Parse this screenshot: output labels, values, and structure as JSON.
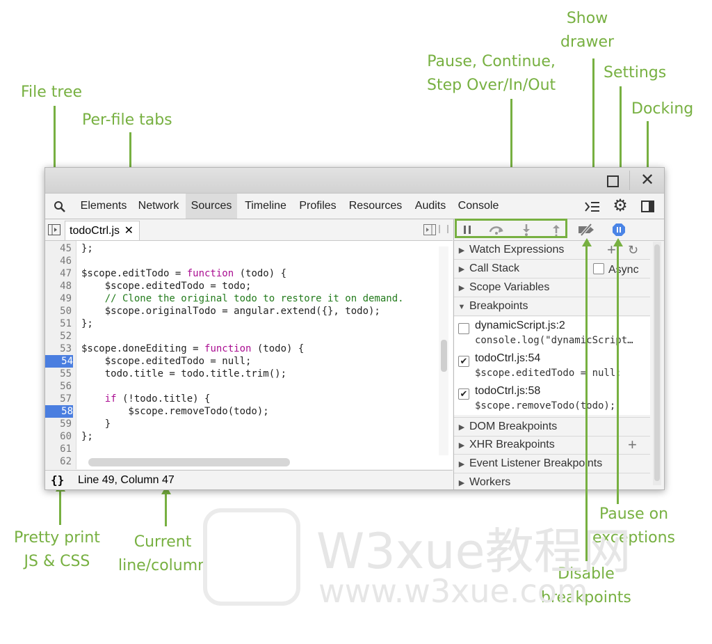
{
  "annotations": {
    "file_tree": "File tree",
    "per_file_tabs": "Per-file tabs",
    "pause_line1": "Pause, Continue,",
    "pause_line2": "Step Over/In/Out",
    "show_drawer_line1": "Show",
    "show_drawer_line2": "drawer",
    "settings": "Settings",
    "docking": "Docking",
    "pretty_print_line1": "Pretty print",
    "pretty_print_line2": "JS & CSS",
    "current_line1": "Current",
    "current_line2": "line/column",
    "pause_exc_line1": "Pause on",
    "pause_exc_line2": "exceptions",
    "disable_bp_line1": "Disable",
    "disable_bp_line2": "breakpoints",
    "color": "#77b041"
  },
  "watermark": {
    "line1": "W3xue教程网",
    "line2": "www.w3xue.com"
  },
  "devtools": {
    "tabs": [
      "Elements",
      "Network",
      "Sources",
      "Timeline",
      "Profiles",
      "Resources",
      "Audits",
      "Console"
    ],
    "active_tab": "Sources",
    "file_tab": "todoCtrl.js",
    "code_lines": [
      {
        "n": "45",
        "bp": false,
        "text": "};"
      },
      {
        "n": "46",
        "bp": false,
        "text": ""
      },
      {
        "n": "47",
        "bp": false,
        "text": "$scope.editTodo = ",
        "kw": "function",
        "rest": " (todo) {"
      },
      {
        "n": "48",
        "bp": false,
        "text": "    $scope.editedTodo = todo;"
      },
      {
        "n": "49",
        "bp": false,
        "comment": "    // Clone the original todo to restore it on demand."
      },
      {
        "n": "50",
        "bp": false,
        "text": "    $scope.originalTodo = angular.extend({}, todo);"
      },
      {
        "n": "51",
        "bp": false,
        "text": "};"
      },
      {
        "n": "52",
        "bp": false,
        "text": ""
      },
      {
        "n": "53",
        "bp": false,
        "text": "$scope.doneEditing = ",
        "kw": "function",
        "rest": " (todo) {"
      },
      {
        "n": "54",
        "bp": true,
        "text": "    $scope.editedTodo = null;"
      },
      {
        "n": "55",
        "bp": false,
        "text": "    todo.title = todo.title.trim();"
      },
      {
        "n": "56",
        "bp": false,
        "text": ""
      },
      {
        "n": "57",
        "bp": false,
        "text": "    ",
        "kw": "if",
        "rest": " (!todo.title) {"
      },
      {
        "n": "58",
        "bp": true,
        "text": "        $scope.removeTodo(todo);"
      },
      {
        "n": "59",
        "bp": false,
        "text": "    }"
      },
      {
        "n": "60",
        "bp": false,
        "text": "};"
      },
      {
        "n": "61",
        "bp": false,
        "text": ""
      },
      {
        "n": "62",
        "bp": false,
        "text": ""
      }
    ],
    "status": "Line 49, Column 47",
    "pretty_print_glyph": "{}",
    "sections": {
      "watch": "Watch Expressions",
      "call_stack": "Call Stack",
      "async": "Async",
      "scope": "Scope Variables",
      "breakpoints": "Breakpoints",
      "dom": "DOM Breakpoints",
      "xhr": "XHR Breakpoints",
      "event": "Event Listener Breakpoints",
      "workers": "Workers"
    },
    "breakpoints": [
      {
        "title": "dynamicScript.js:2",
        "code": "console.log(\"dynamicScript…",
        "checked": false
      },
      {
        "title": "todoCtrl.js:54",
        "code": "$scope.editedTodo = null;",
        "checked": true
      },
      {
        "title": "todoCtrl.js:58",
        "code": "$scope.removeTodo(todo);",
        "checked": true
      }
    ]
  }
}
